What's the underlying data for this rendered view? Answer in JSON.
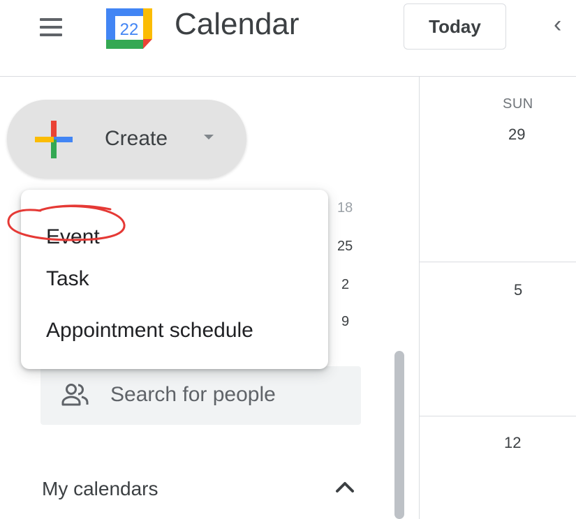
{
  "header": {
    "logo_day": "22",
    "app_title": "Calendar",
    "today_label": "Today",
    "prev_glyph": "‹"
  },
  "create": {
    "label": "Create"
  },
  "menu": {
    "items": [
      {
        "label": "Event"
      },
      {
        "label": "Task"
      },
      {
        "label": "Appointment schedule"
      }
    ]
  },
  "mini_calendar": {
    "partial_top": "18",
    "visible_days": [
      "25",
      "2",
      "9"
    ]
  },
  "search": {
    "placeholder": "Search for people"
  },
  "sidebar": {
    "my_calendars_label": "My calendars"
  },
  "grid": {
    "day_name": "SUN",
    "day_numbers": [
      "29",
      "5",
      "12"
    ]
  },
  "colors": {
    "google_blue": "#4285f4",
    "google_red": "#ea4335",
    "google_yellow": "#fbbc04",
    "google_green": "#34a853",
    "annotation_red": "#e53935"
  },
  "icons": [
    "hamburger-menu-icon",
    "calendar-logo-icon",
    "chevron-left-icon",
    "plus-icon",
    "caret-down-icon",
    "people-icon",
    "chevron-up-icon"
  ]
}
